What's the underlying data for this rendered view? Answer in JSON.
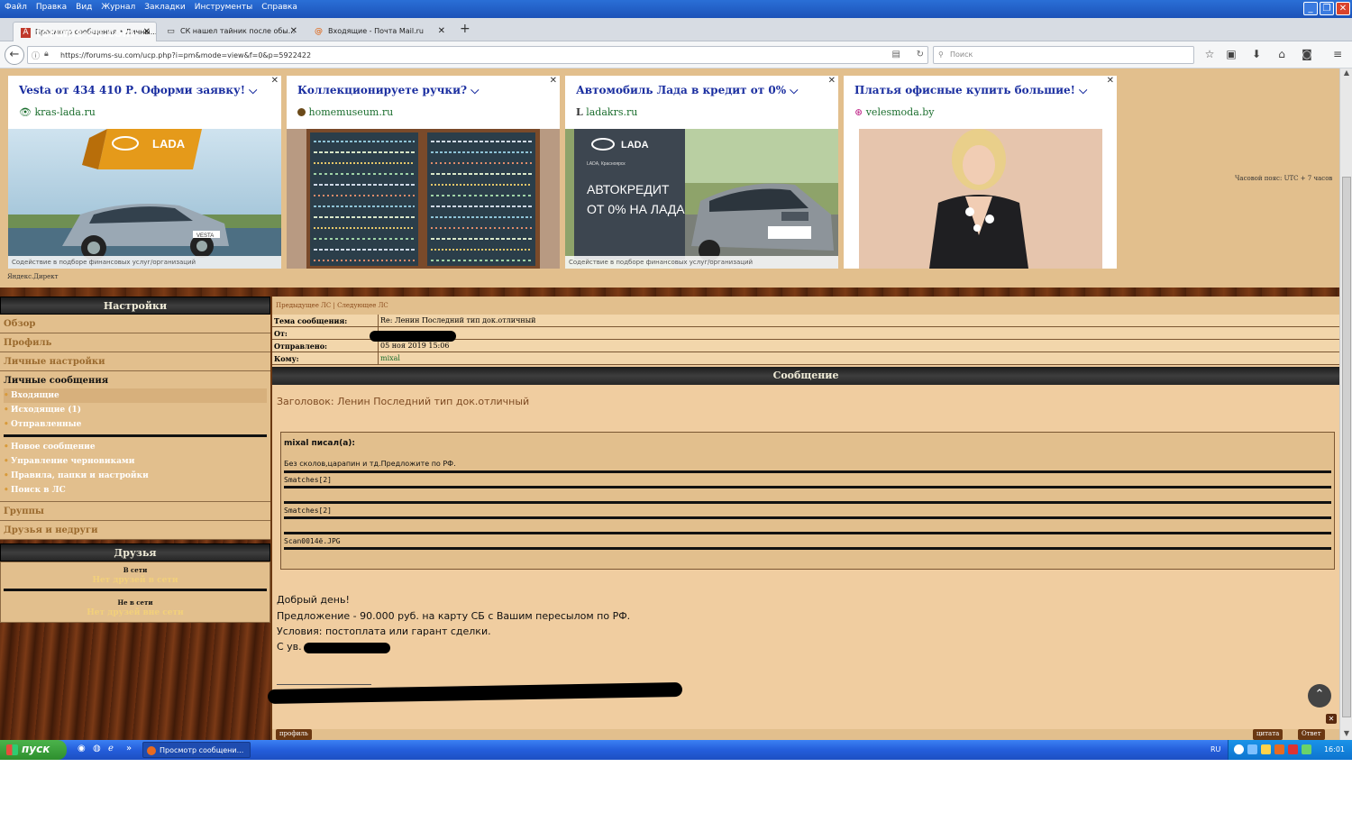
{
  "menubar": {
    "items": [
      "Файл",
      "Правка",
      "Вид",
      "Журнал",
      "Закладки",
      "Инструменты",
      "Справка"
    ]
  },
  "tabs": [
    {
      "title": "Просмотр сообщения • Личны...",
      "active": true
    },
    {
      "title": "СК нашел тайник после обы...",
      "active": false
    },
    {
      "title": "Входящие - Почта Mail.ru",
      "active": false
    }
  ],
  "watermark": "forums-su.com",
  "navbar": {
    "url": "https://forums-su.com/ucp.php?i=pm&mode=view&f=0&p=5922422",
    "search_placeholder": "Поиск"
  },
  "ads": [
    {
      "title": "Vesta от 434 410 Р. Оформи заявку!",
      "domain": "kras-lada.ru",
      "brand": "LADA",
      "model": "VESTA",
      "caption": "Содействие в подборе финансовых услуг/организаций"
    },
    {
      "title": "Коллекционируете ручки?",
      "domain": "homemuseum.ru",
      "caption": ""
    },
    {
      "title": "Автомобиль Лада в кредит от 0%",
      "domain": "ladakrs.ru",
      "brand": "LADA",
      "sub": "LADA, Красноярск",
      "promo_line1": "АВТОКРЕДИТ",
      "promo_line2": "ОТ 0% НА ЛАДА",
      "caption": "Содействие в подборе финансовых услуг/организаций"
    },
    {
      "title": "Платья офисные купить большие!",
      "domain": "velesmoda.by",
      "caption": ""
    }
  ],
  "yandex_direct": "Яндекс.Директ",
  "timezone": "Часовой пояс: UTC + 7 часов",
  "sidebar": {
    "header": "Настройки",
    "items": [
      "Обзор",
      "Профиль",
      "Личные настройки"
    ],
    "pm_header": "Личные сообщения",
    "pm_links": [
      "Входящие",
      "Исходящие (1)",
      "Отправленные"
    ],
    "pm_tools": [
      "Новое сообщение",
      "Управление черновиками",
      "Правила, папки и настройки",
      "Поиск в ЛС"
    ],
    "bottom_items": [
      "Группы",
      "Друзья и недруги"
    ],
    "friends_header": "Друзья",
    "online_label": "В сети",
    "online_empty": "Нет друзей в сети",
    "offline_label": "Не в сети",
    "offline_empty": "Нет друзей вне сети"
  },
  "message": {
    "nav_prev": "Предыдущее ЛС",
    "nav_sep": "|",
    "nav_next": "Следующее ЛС",
    "subject_label": "Тема сообщения:",
    "subject": "Re: Ленин Последний тип док.отличный",
    "from_label": "От:",
    "sent_label": "Отправлено:",
    "sent": "05 ноя 2019 15:06",
    "to_label": "Кому:",
    "to": "mixal",
    "section_header": "Сообщение",
    "title": "Заголовок: Ленин Последний тип док.отличный",
    "quote_author": "mixal писал(а):",
    "quote_text": "Без сколов,царапин и тд.Предложите по РФ.",
    "attachments": [
      "Smatches[2]",
      "Smatches[2]",
      "Scan0014ё.JPG"
    ],
    "body": [
      "Добрый день!",
      "Предложение - 90.000 руб. на карту СБ с Вашим пересылом по РФ.",
      "Условия: постоплата или гарант сделки.",
      "С ув."
    ],
    "buttons": {
      "profile": "профиль",
      "quote": "цитата",
      "reply": "Ответ"
    }
  },
  "taskbar": {
    "start": "пуск",
    "task": "Просмотр сообщени...",
    "lang": "RU",
    "clock": "16:01"
  }
}
